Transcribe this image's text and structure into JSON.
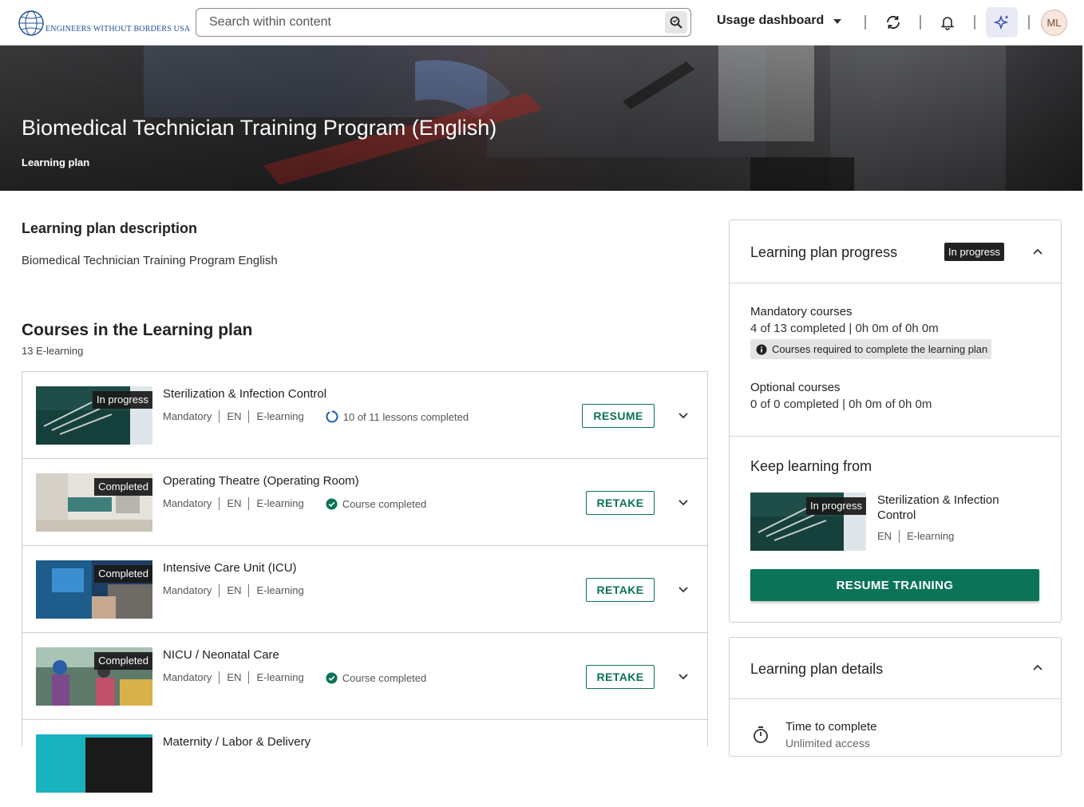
{
  "header": {
    "logo_text": "ENGINEERS WITHOUT BORDERS USA",
    "search_placeholder": "Search within content",
    "dashboard_label": "Usage dashboard",
    "avatar_initials": "ML"
  },
  "hero": {
    "title": "Biomedical Technician Training Program (English)",
    "subtitle": "Learning plan"
  },
  "description": {
    "heading": "Learning plan description",
    "text": "Biomedical Technician Training Program English"
  },
  "courses": {
    "heading": "Courses in the Learning plan",
    "count": "13 E-learning",
    "items": [
      {
        "badge": "In progress",
        "title": "Sterilization & Infection Control",
        "req": "Mandatory",
        "lang": "EN",
        "type": "E-learning",
        "status": "10 of 11 lessons completed",
        "action": "RESUME",
        "progress": 0.909
      },
      {
        "badge": "Completed",
        "title": "Operating Theatre (Operating Room)",
        "req": "Mandatory",
        "lang": "EN",
        "type": "E-learning",
        "status": "Course completed",
        "action": "RETAKE"
      },
      {
        "badge": "Completed",
        "title": "Intensive Care Unit (ICU)",
        "req": "Mandatory",
        "lang": "EN",
        "type": "E-learning",
        "status": "",
        "action": "RETAKE"
      },
      {
        "badge": "Completed",
        "title": "NICU / Neonatal Care",
        "req": "Mandatory",
        "lang": "EN",
        "type": "E-learning",
        "status": "Course completed",
        "action": "RETAKE"
      },
      {
        "badge": "",
        "title": "Maternity / Labor & Delivery",
        "req": "",
        "lang": "",
        "type": "",
        "status": "",
        "action": ""
      }
    ]
  },
  "progress_panel": {
    "title": "Learning plan progress",
    "badge": "In progress",
    "mandatory_label": "Mandatory courses",
    "mandatory_value": "4 of 13 completed | 0h 0m of 0h 0m",
    "info_chip": "Courses required to complete the learning plan",
    "optional_label": "Optional courses",
    "optional_value": "0 of 0 completed | 0h 0m of 0h 0m",
    "keep_heading": "Keep learning from",
    "keep_badge": "In progress",
    "keep_title": "Sterilization & Infection Control",
    "keep_lang": "EN",
    "keep_type": "E-learning",
    "resume_label": "RESUME TRAINING"
  },
  "details_panel": {
    "title": "Learning plan details",
    "time_label": "Time to complete",
    "time_value": "Unlimited access"
  },
  "colors": {
    "accent_green": "#0b7358",
    "progress_blue": "#1d5fa8",
    "brand_blue": "#1d4f9c"
  }
}
